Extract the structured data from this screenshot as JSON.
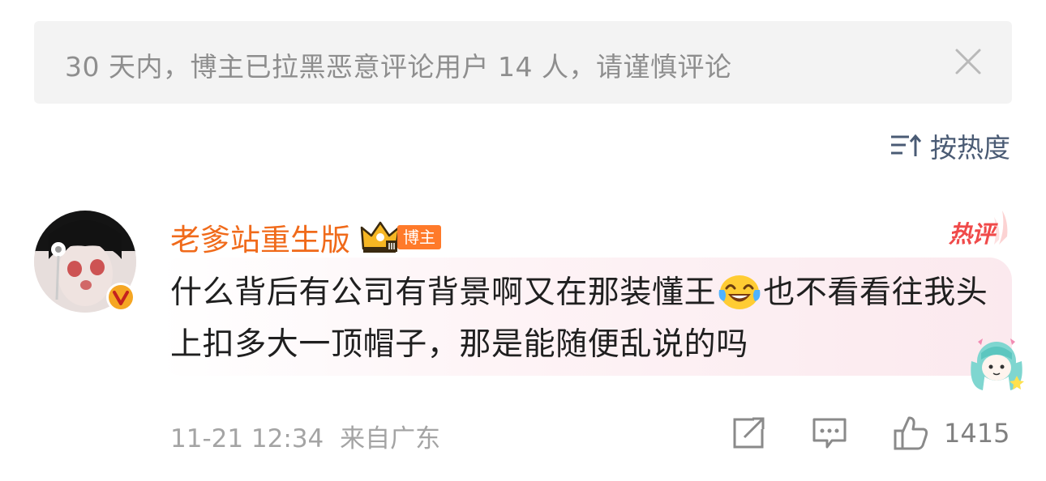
{
  "notice": {
    "text": "30 天内，博主已拉黑恶意评论用户 14 人，请谨慎评论",
    "close_icon": "close-icon"
  },
  "sort": {
    "label": "按热度",
    "icon": "sort-icon"
  },
  "comment": {
    "author": "老爹站重生版",
    "author_tag": "博主",
    "hot_badge": "热评",
    "text_before_emoji": "什么背后有公司有背景啊又在那装懂王",
    "emoji": "laugh-cry-emoji",
    "text_after_emoji": "也不看看往我头上扣多大一顶帽子，那是能随便乱说的吗",
    "timestamp": "11-21 12:34",
    "location": "来自广东",
    "like_count": "1415"
  },
  "colors": {
    "author": "#f06a1a",
    "notice_bg": "#f3f3f3",
    "sort_label": "#4a5b74",
    "hot": "#f04a4a",
    "verified": "#f5a623"
  }
}
